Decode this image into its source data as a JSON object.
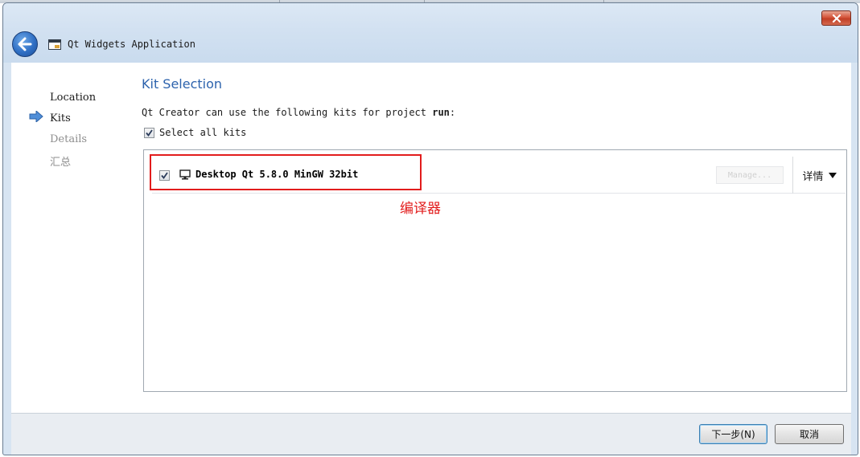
{
  "window": {
    "title": "Qt Widgets Application",
    "close_icon": "close-icon",
    "back_icon": "back-arrow-icon",
    "app_icon": "window-app-icon"
  },
  "steps": [
    {
      "label": "Location",
      "state": "done"
    },
    {
      "label": "Kits",
      "state": "active"
    },
    {
      "label": "Details",
      "state": "pending"
    },
    {
      "label": "汇总",
      "state": "pending"
    }
  ],
  "page": {
    "title": "Kit Selection",
    "description_prefix": "Qt Creator can use the following kits for project ",
    "project_name": "run",
    "description_suffix": ":",
    "select_all_label": "Select all kits",
    "select_all_checked": true
  },
  "kits": [
    {
      "label": "Desktop Qt 5.8.0 MinGW 32bit",
      "checked": true,
      "manage_label": "Manage...",
      "details_label": "详情"
    }
  ],
  "annotation": {
    "text": "编译器",
    "color": "#e21c1c"
  },
  "footer": {
    "next_label": "下一步(N)",
    "cancel_label": "取消"
  },
  "colors": {
    "accent": "#2d63ad",
    "highlight": "#e21c1c"
  }
}
